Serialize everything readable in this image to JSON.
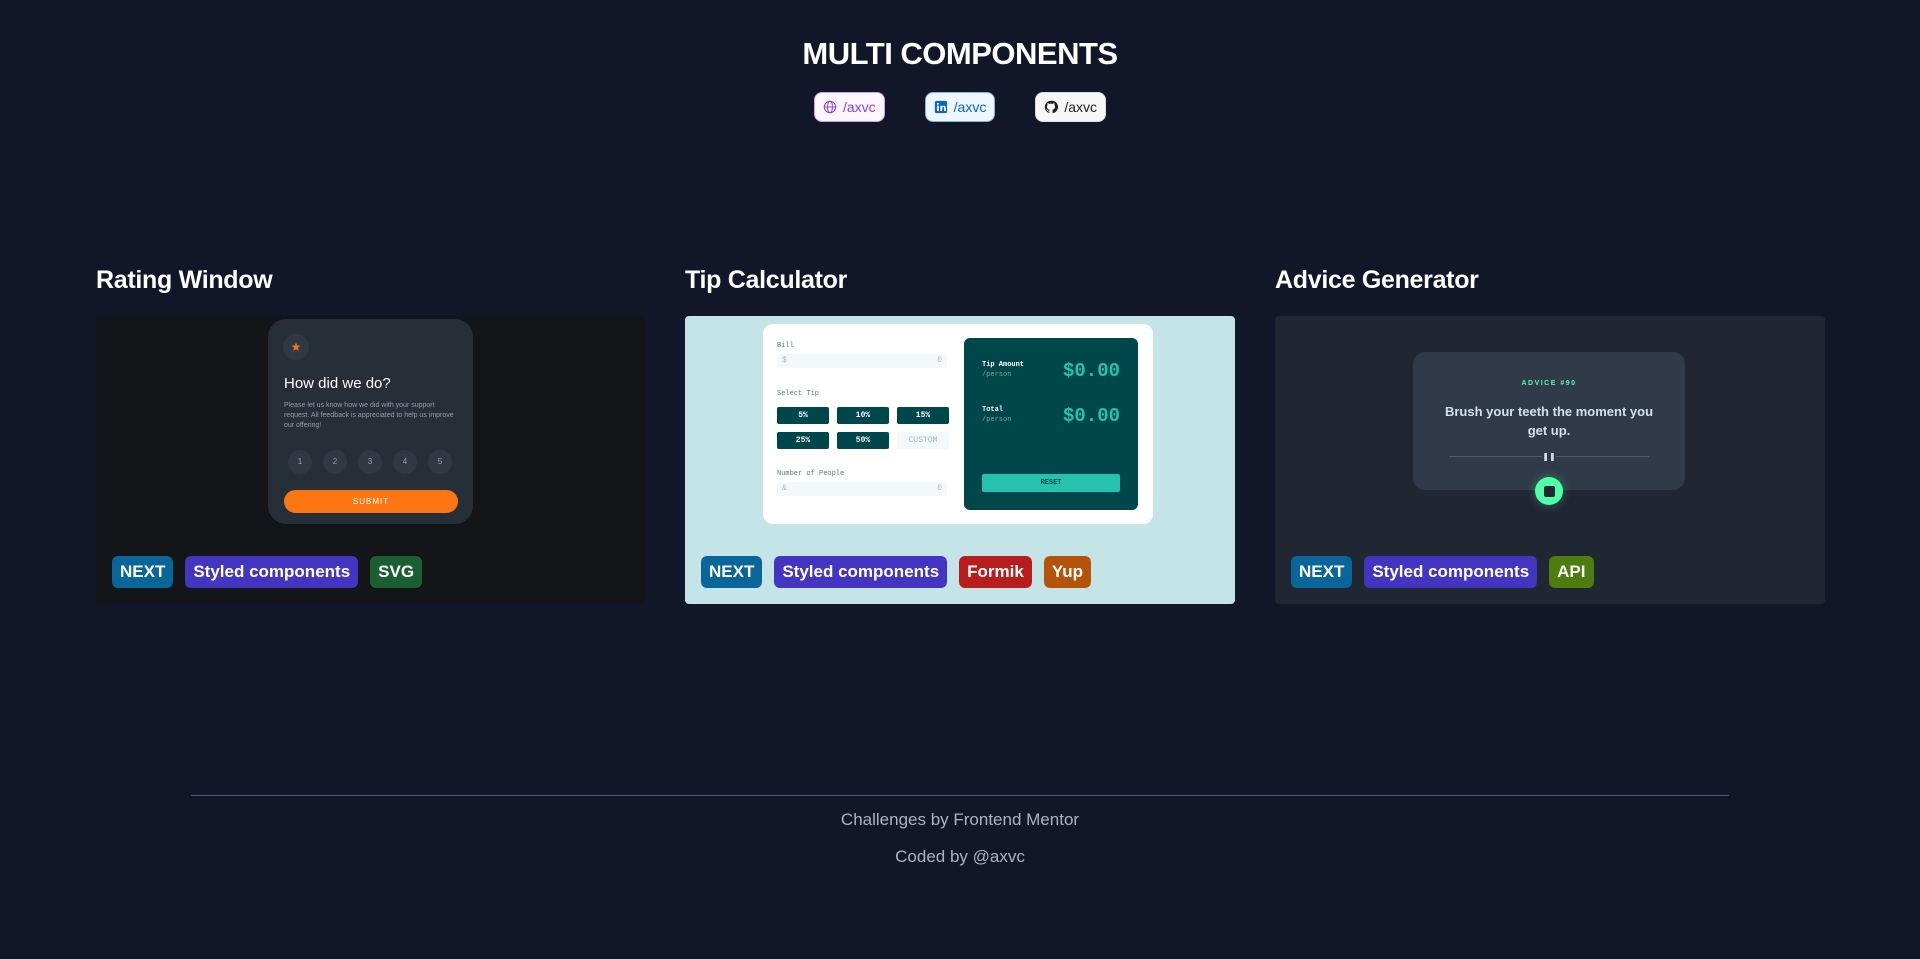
{
  "header": {
    "title": "MULTI COMPONENTS",
    "links": [
      {
        "label": "/axvc",
        "icon": "globe-icon"
      },
      {
        "label": "/axvc",
        "icon": "linkedin-icon"
      },
      {
        "label": "/axvc",
        "icon": "github-icon"
      }
    ]
  },
  "cards": [
    {
      "title": "Rating Window",
      "preview": {
        "heading": "How did we do?",
        "text": "Please let us know how we did with your support request. All feedback is appreciated to help us improve our offering!",
        "ratings": [
          "1",
          "2",
          "3",
          "4",
          "5"
        ],
        "submit": "SUBMIT"
      },
      "tags": [
        {
          "label": "NEXT",
          "color": "#0a6598"
        },
        {
          "label": "Styled components",
          "color": "#4434c2"
        },
        {
          "label": "SVG",
          "color": "#1b5e31"
        }
      ]
    },
    {
      "title": "Tip Calculator",
      "preview": {
        "bill_label": "Bill",
        "bill_prefix": "$",
        "bill_value": "0",
        "select_tip_label": "Select Tip",
        "tips": [
          "5%",
          "10%",
          "15%",
          "25%",
          "50%",
          "CUSTOM"
        ],
        "people_label": "Number of People",
        "people_prefix": "&",
        "people_value": "0",
        "tip_amount_label": "Tip Amount",
        "per_person": "/person",
        "tip_amount_value": "$0.00",
        "total_label": "Total",
        "total_value": "$0.00",
        "reset": "RESET"
      },
      "tags": [
        {
          "label": "NEXT",
          "color": "#0a6598"
        },
        {
          "label": "Styled components",
          "color": "#4434c2"
        },
        {
          "label": "Formik",
          "color": "#b91c1c"
        },
        {
          "label": "Yup",
          "color": "#b45309"
        }
      ]
    },
    {
      "title": "Advice Generator",
      "preview": {
        "advice_number": "ADVICE #90",
        "quote": "Brush your teeth the moment you get up.",
        "pause": "❚❚"
      },
      "tags": [
        {
          "label": "NEXT",
          "color": "#0a6598"
        },
        {
          "label": "Styled components",
          "color": "#4434c2"
        },
        {
          "label": "API",
          "color": "#4d7c0f"
        }
      ]
    }
  ],
  "footer": {
    "credits": "Challenges by Frontend Mentor",
    "coded_by": "Coded by @axvc"
  }
}
